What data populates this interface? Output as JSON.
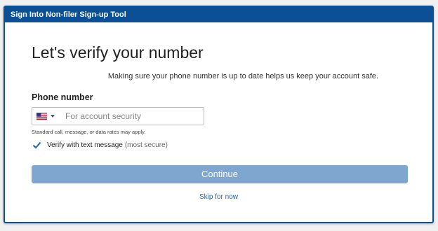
{
  "window": {
    "title": "Sign Into Non-filer Sign-up Tool"
  },
  "page": {
    "heading": "Let's verify your number",
    "subtext": "Making sure your phone number is up to date helps us keep your account safe."
  },
  "phone": {
    "label": "Phone number",
    "country": "us-flag-icon",
    "placeholder": "For account security",
    "value": "",
    "rates_notice": "Standard call, message, or data rates may apply."
  },
  "verify": {
    "checked": true,
    "label": "Verify with text message",
    "note": "(most secure)"
  },
  "actions": {
    "continue_label": "Continue",
    "skip_label": "Skip for now"
  },
  "colors": {
    "brand": "#0b4f96",
    "button": "#7fa6cf",
    "link": "#1f66b3"
  }
}
